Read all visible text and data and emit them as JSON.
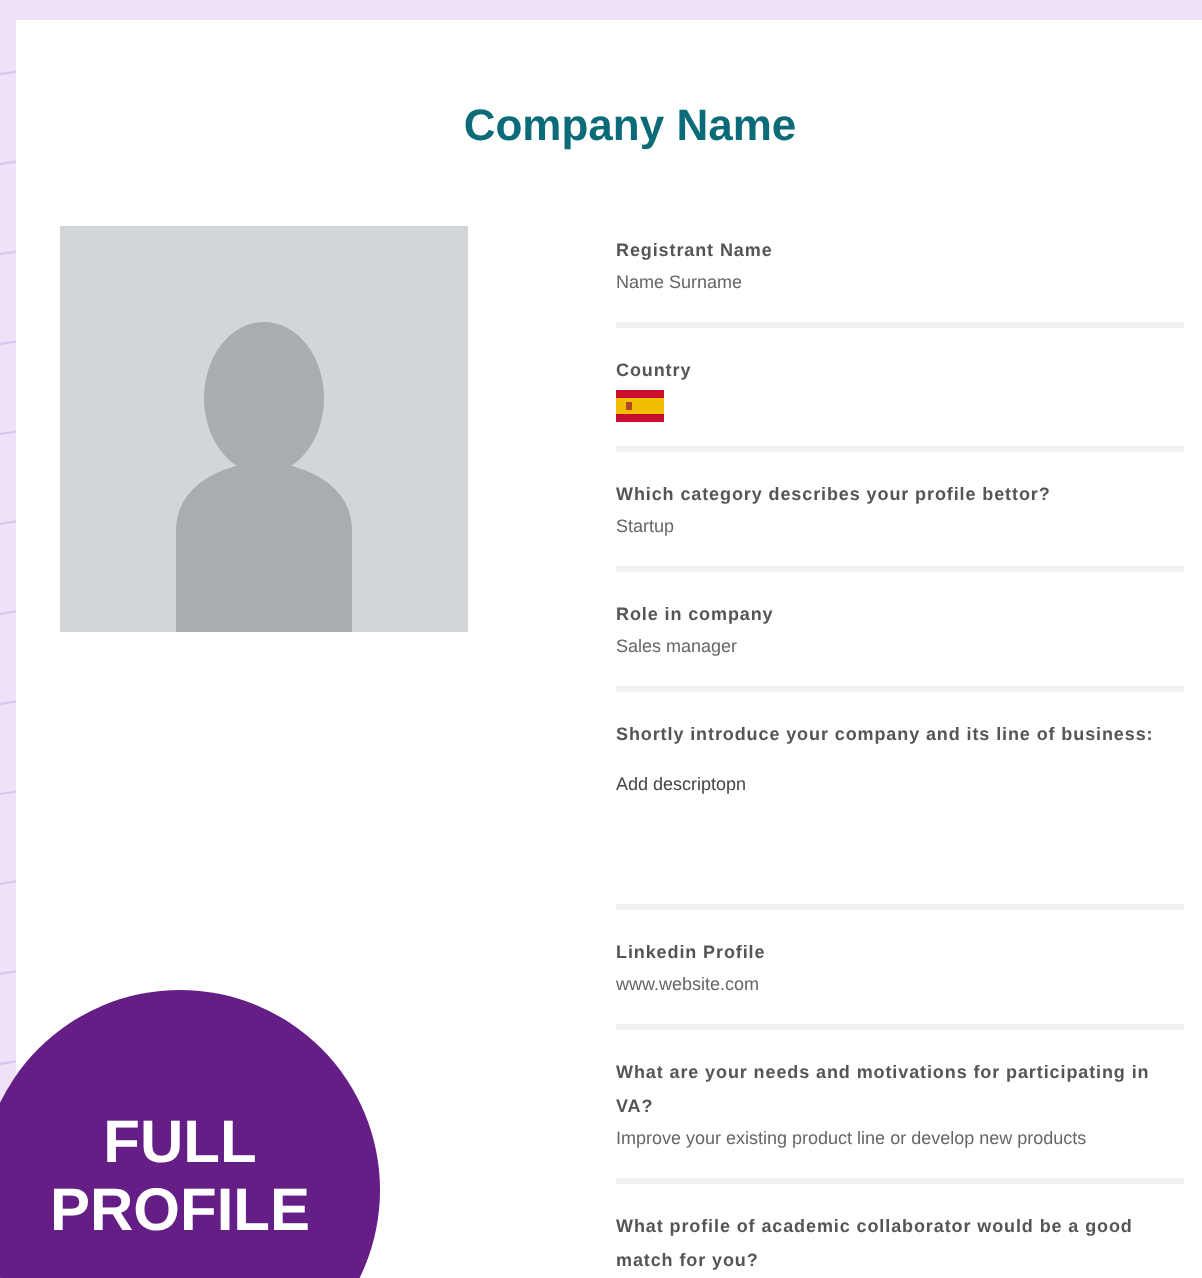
{
  "title": "Company Name",
  "fields": [
    {
      "kind": "text",
      "label": "Registrant Name",
      "value": "Name Surname"
    },
    {
      "kind": "flag",
      "label": "Country"
    },
    {
      "kind": "text",
      "label": "Which category describes your profile bettor?",
      "value": "Startup"
    },
    {
      "kind": "text",
      "label": "Role in company",
      "value": "Sales manager"
    },
    {
      "kind": "long",
      "label": "Shortly introduce your company and its line of business:",
      "value": "Add descriptopn"
    },
    {
      "kind": "text",
      "label": "Linkedin Profile",
      "value": "www.website.com"
    },
    {
      "kind": "text",
      "label": "What are your needs and motivations for participating in VA?",
      "value": "Improve your existing product line or develop new products"
    },
    {
      "kind": "text",
      "label": "What profile of academic collaborator would be a good match for you?"
    }
  ],
  "badge": [
    "FULL",
    "PROFILE"
  ]
}
